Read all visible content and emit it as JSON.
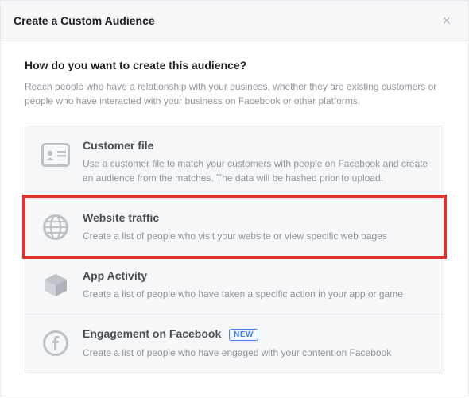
{
  "header": {
    "title": "Create a Custom Audience"
  },
  "intro": {
    "question": "How do you want to create this audience?",
    "subtext": "Reach people who have a relationship with your business, whether they are existing customers or people who have interacted with your business on Facebook or other platforms."
  },
  "options": [
    {
      "label": "Customer file",
      "desc": "Use a customer file to match your customers with people on Facebook and create an audience from the matches. The data will be hashed prior to upload.",
      "badge": null
    },
    {
      "label": "Website traffic",
      "desc": "Create a list of people who visit your website or view specific web pages",
      "badge": null
    },
    {
      "label": "App Activity",
      "desc": "Create a list of people who have taken a specific action in your app or game",
      "badge": null
    },
    {
      "label": "Engagement on Facebook",
      "desc": "Create a list of people who have engaged with your content on Facebook",
      "badge": "NEW"
    }
  ]
}
